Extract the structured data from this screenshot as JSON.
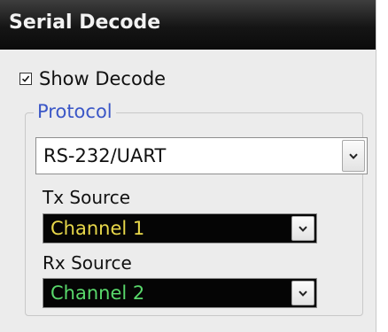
{
  "panel": {
    "title": "Serial Decode"
  },
  "show_decode": {
    "label": "Show Decode",
    "checked": true
  },
  "protocol": {
    "group_label": "Protocol",
    "selected": "RS-232/UART"
  },
  "tx_source": {
    "label": "Tx Source",
    "selected": "Channel 1",
    "color": "#e8d84a"
  },
  "rx_source": {
    "label": "Rx Source",
    "selected": "Channel 2",
    "color": "#59d86b"
  },
  "icons": {
    "checkbox": "checkmark-icon",
    "dropdown": "chevron-down-icon"
  }
}
